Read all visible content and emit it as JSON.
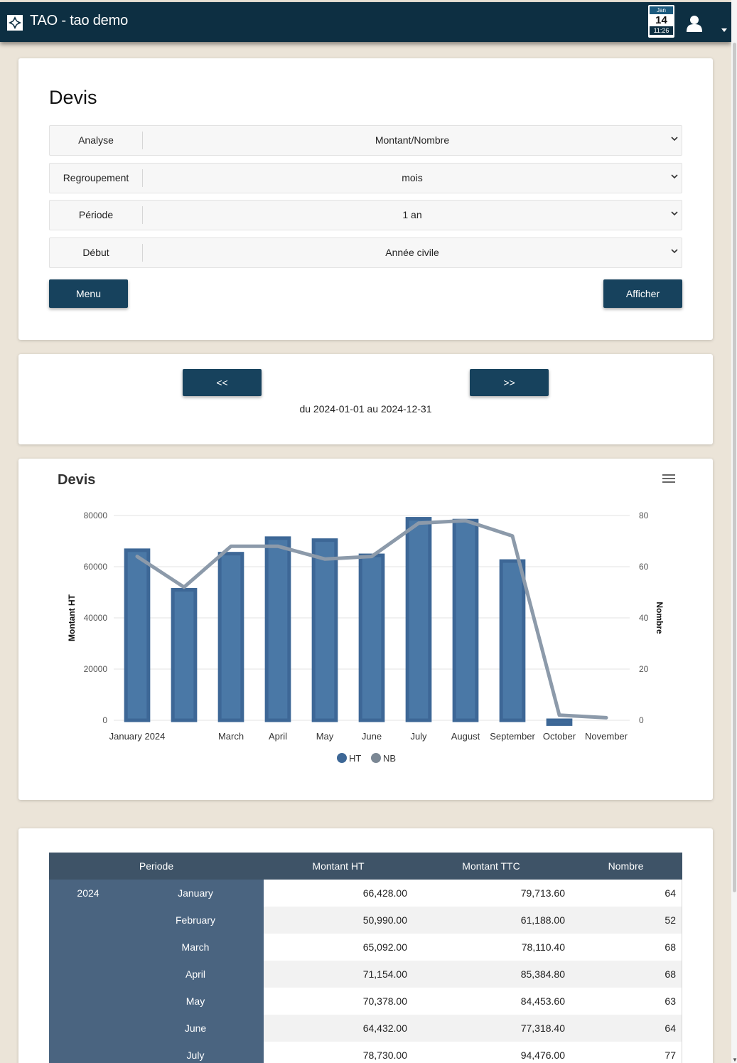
{
  "header": {
    "app_title": "TAO - tao demo",
    "calendar": {
      "month": "Jan",
      "day": "14",
      "time": "11:26"
    }
  },
  "form": {
    "title": "Devis",
    "rows": [
      {
        "label": "Analyse",
        "value": "Montant/Nombre"
      },
      {
        "label": "Regroupement",
        "value": "mois"
      },
      {
        "label": "Période",
        "value": "1 an"
      },
      {
        "label": "Début",
        "value": "Année civile"
      }
    ],
    "menu_label": "Menu",
    "show_label": "Afficher"
  },
  "nav": {
    "prev_label": "<<",
    "next_label": ">>",
    "period_text": "du 2024-01-01 au 2024-12-31"
  },
  "chart_data": {
    "type": "bar",
    "title": "Devis",
    "categories": [
      "January 2024",
      "February",
      "March",
      "April",
      "May",
      "June",
      "July",
      "August",
      "September",
      "October",
      "November"
    ],
    "tick_labels": [
      "January 2024",
      "",
      "March",
      "April",
      "May",
      "June",
      "July",
      "August",
      "September",
      "October",
      "November"
    ],
    "series": [
      {
        "name": "HT",
        "type": "bar",
        "axis": "left",
        "color": "#3d6796",
        "values": [
          66428,
          50990,
          65092,
          71154,
          70378,
          64432,
          78730,
          78000,
          62200,
          -1500,
          0
        ]
      },
      {
        "name": "NB",
        "type": "line",
        "axis": "right",
        "color": "#8c9aaa",
        "values": [
          64,
          52,
          68,
          68,
          63,
          64,
          77,
          78,
          72,
          2,
          1
        ]
      }
    ],
    "ylabel": "Montant HT",
    "y2label": "Nombre",
    "ylim": [
      0,
      80000
    ],
    "y2lim": [
      0,
      80
    ],
    "yticks": [
      "0",
      "20000",
      "40000",
      "60000",
      "80000"
    ],
    "y2ticks": [
      "0",
      "20",
      "40",
      "60",
      "80"
    ],
    "grid": true,
    "legend": "bottom"
  },
  "table": {
    "headers": [
      "Periode",
      "Montant HT",
      "Montant TTC",
      "Nombre"
    ],
    "year": "2024",
    "rows": [
      {
        "month": "January",
        "ht": "66,428.00",
        "ttc": "79,713.60",
        "nb": "64"
      },
      {
        "month": "February",
        "ht": "50,990.00",
        "ttc": "61,188.00",
        "nb": "52"
      },
      {
        "month": "March",
        "ht": "65,092.00",
        "ttc": "78,110.40",
        "nb": "68"
      },
      {
        "month": "April",
        "ht": "71,154.00",
        "ttc": "85,384.80",
        "nb": "68"
      },
      {
        "month": "May",
        "ht": "70,378.00",
        "ttc": "84,453.60",
        "nb": "63"
      },
      {
        "month": "June",
        "ht": "64,432.00",
        "ttc": "77,318.40",
        "nb": "64"
      },
      {
        "month": "July",
        "ht": "78,730.00",
        "ttc": "94,476.00",
        "nb": "77"
      }
    ]
  }
}
